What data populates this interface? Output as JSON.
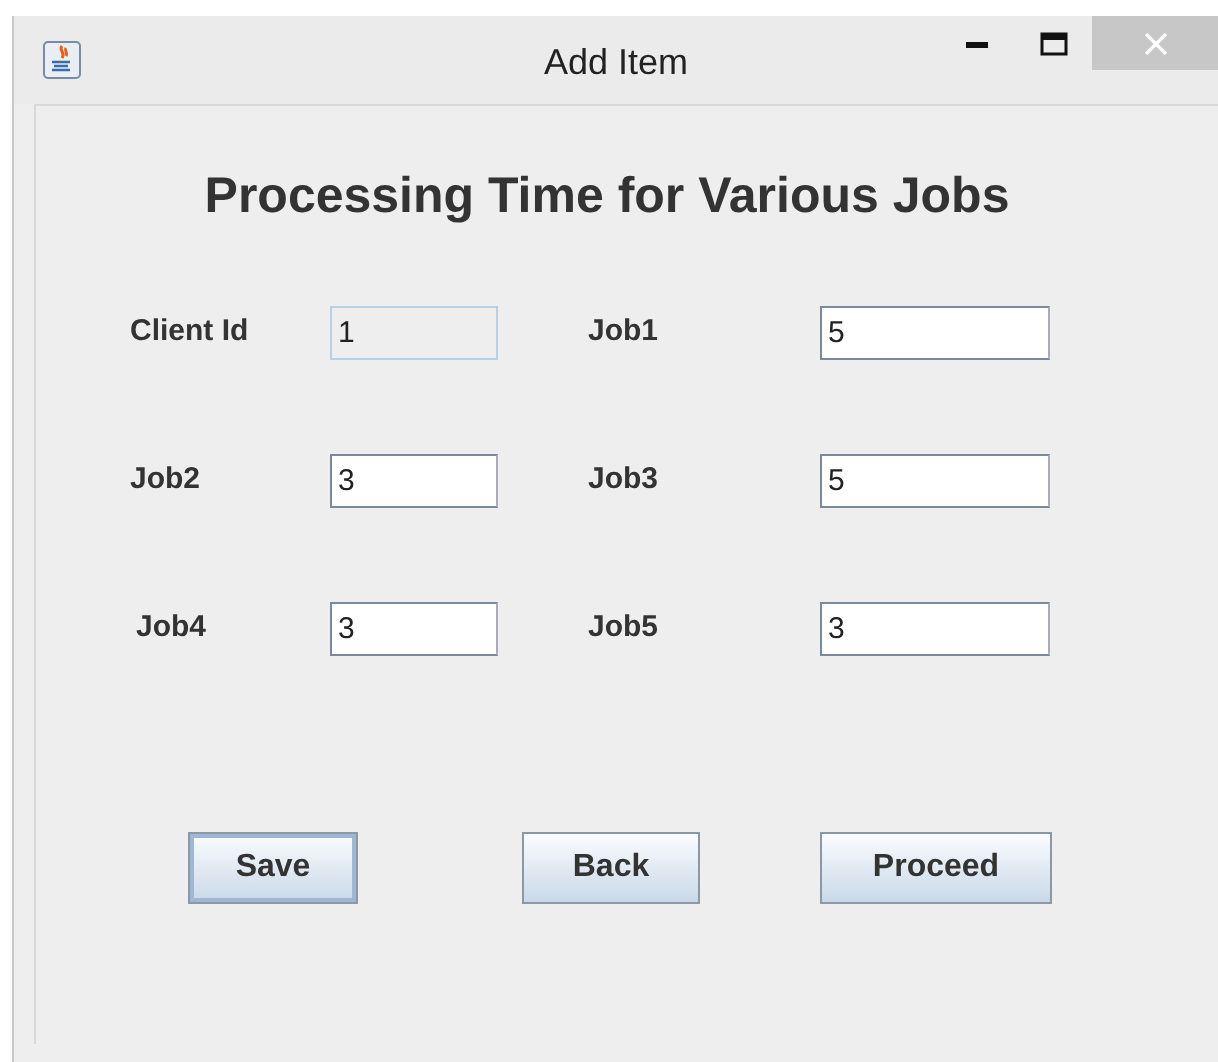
{
  "window": {
    "title": "Add Item"
  },
  "heading": "Processing Time for Various Jobs",
  "rows": [
    [
      {
        "label": "Client Id",
        "value": "1",
        "disabled": true
      },
      {
        "label": "Job1",
        "value": "5",
        "disabled": false
      }
    ],
    [
      {
        "label": "Job2",
        "value": "3",
        "disabled": false
      },
      {
        "label": "Job3",
        "value": "5",
        "disabled": false
      }
    ],
    [
      {
        "label": "Job4",
        "value": "3",
        "disabled": false
      },
      {
        "label": "Job5",
        "value": "3",
        "disabled": false
      }
    ]
  ],
  "buttons": [
    {
      "label": "Save",
      "focused": true
    },
    {
      "label": "Back",
      "focused": false
    },
    {
      "label": "Proceed",
      "focused": false
    }
  ]
}
